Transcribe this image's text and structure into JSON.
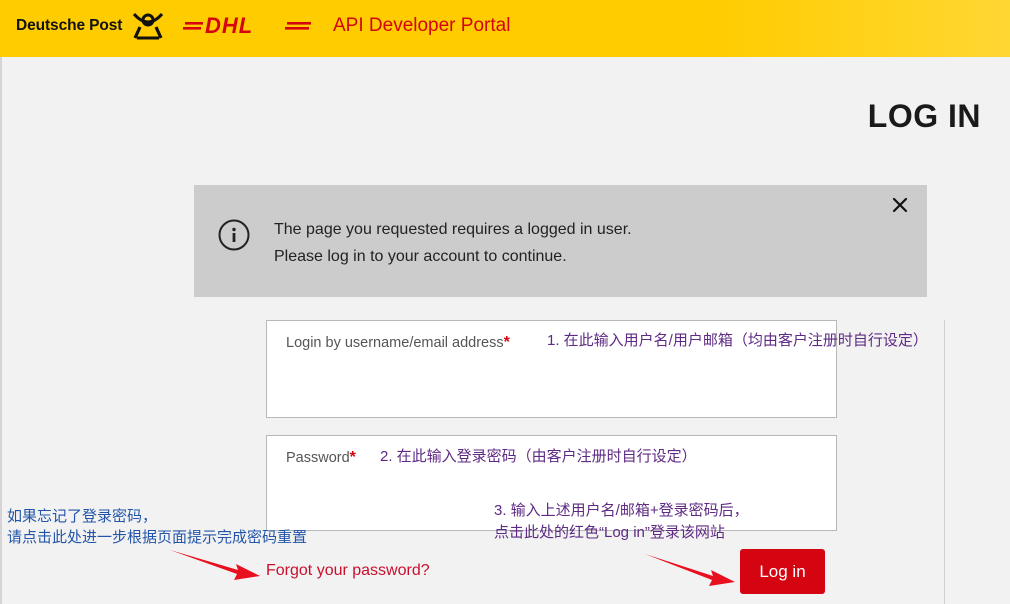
{
  "header": {
    "deutsche_post_logo_text": "Deutsche Post",
    "dhl_logo_text": "DHL",
    "portal_title": "API Developer Portal"
  },
  "page": {
    "title": "LOG IN"
  },
  "alert": {
    "line1": "The page you requested requires a logged in user.",
    "line2": "Please log in to your account to continue."
  },
  "form": {
    "username_label": "Login by username/email address",
    "password_label": "Password",
    "required_mark": "*",
    "forgot_link": "Forgot your password?",
    "login_button": "Log in"
  },
  "annotations": {
    "note1": "1. 在此输入用户名/用户邮箱（均由客户注册时自行设定）",
    "note2": "2. 在此输入登录密码（由客户注册时自行设定）",
    "note3_line1": "3. 输入上述用户名/邮箱+登录密码后，",
    "note3_line2": "点击此处的红色“Log in”登录该网站",
    "forgot_note_line1": "如果忘记了登录密码，",
    "forgot_note_line2": "请点击此处进一步根据页面提示完成密码重置"
  },
  "colors": {
    "brand_yellow": "#ffcc00",
    "brand_red": "#d40511",
    "annotation_purple": "#5e2a84",
    "annotation_blue": "#2255aa"
  },
  "icons": {
    "info": "info-circle-icon",
    "close": "close-x-icon",
    "post_horn": "post-horn-icon"
  }
}
